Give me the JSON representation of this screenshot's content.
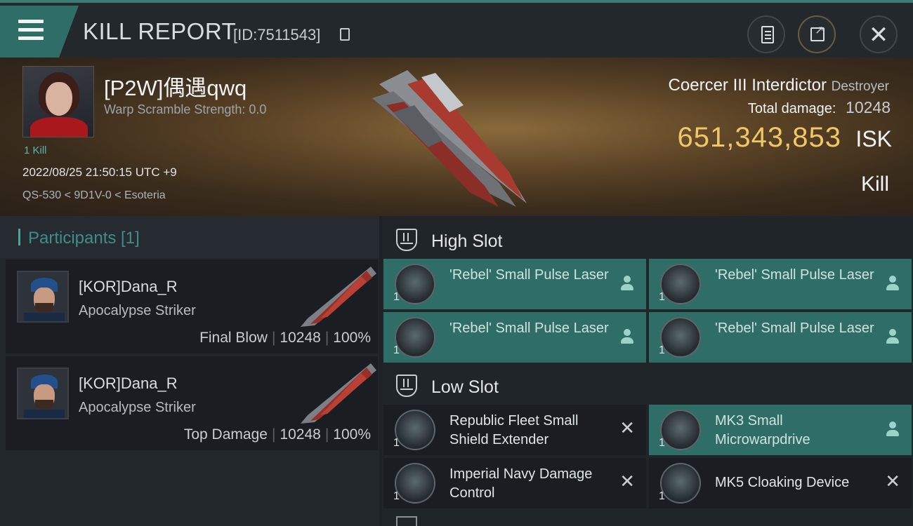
{
  "title": {
    "text": "KILL REPORT",
    "id": "[ID:7511543]"
  },
  "victim": {
    "name": "[P2W]偶遇qwq",
    "warp_scramble": "Warp Scramble Strength: 0.0",
    "kill_count": "1 Kill",
    "datetime": "2022/08/25 21:50:15 UTC +9",
    "location": "QS-530 < 9D1V-0 < Esoteria"
  },
  "ship": {
    "name": "Coercer III Interdictor",
    "class": "Destroyer",
    "damage_label": "Total damage:",
    "damage_value": "10248",
    "isk_value": "651,343,853",
    "isk_unit": "ISK",
    "result": "Kill"
  },
  "participants": {
    "header": "Participants [1]",
    "rows": [
      {
        "name": "[KOR]Dana_R",
        "ship": "Apocalypse Striker",
        "role": "Final Blow",
        "damage": "10248",
        "percent": "100%"
      },
      {
        "name": "[KOR]Dana_R",
        "ship": "Apocalypse Striker",
        "role": "Top Damage",
        "damage": "10248",
        "percent": "100%"
      }
    ]
  },
  "fitting": {
    "high_slot_label": "High Slot",
    "low_slot_label": "Low Slot",
    "high": [
      {
        "name": "'Rebel' Small Pulse Laser",
        "qty": "1",
        "state": "dropped",
        "icon": "pulse-laser-icon"
      },
      {
        "name": "'Rebel' Small Pulse Laser",
        "qty": "1",
        "state": "dropped",
        "icon": "pulse-laser-icon"
      },
      {
        "name": "'Rebel' Small Pulse Laser",
        "qty": "1",
        "state": "dropped",
        "icon": "pulse-laser-icon"
      },
      {
        "name": "'Rebel' Small Pulse Laser",
        "qty": "1",
        "state": "dropped",
        "icon": "pulse-laser-icon"
      }
    ],
    "low": [
      {
        "name": "Republic Fleet Small Shield Extender",
        "qty": "1",
        "state": "destroyed",
        "icon": "shield-extender-icon"
      },
      {
        "name": "MK3 Small Microwarpdrive",
        "qty": "1",
        "state": "dropped",
        "icon": "microwarpdrive-icon"
      },
      {
        "name": "Imperial Navy Damage Control",
        "qty": "1",
        "state": "destroyed",
        "icon": "damage-control-icon"
      },
      {
        "name": "MK5 Cloaking Device",
        "qty": "1",
        "state": "destroyed",
        "icon": "cloaking-device-icon"
      }
    ]
  },
  "colors": {
    "accent": "#2f6d67",
    "isk": "#f0c766",
    "participants_title": "#3f8f86"
  }
}
